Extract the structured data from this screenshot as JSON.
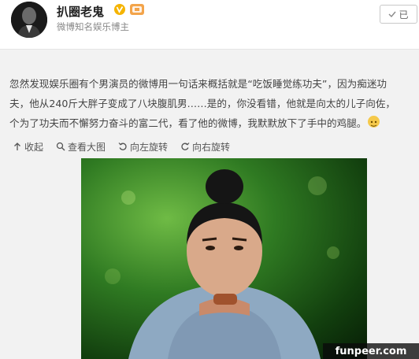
{
  "header": {
    "username": "扒圈老鬼",
    "subtitle": "微博知名娱乐博主",
    "follow_label": "已"
  },
  "post": {
    "lines": [
      "忽然发现娱乐圈有个男演员的微博用一句话来概括就是“吃饭睡觉练功夫”，因为痴迷功",
      "夫，他从240斤大胖子变成了八块腹肌男……是的，你没看错，他就是向太的儿子向佐，",
      "个为了功夫而不懈努力奋斗的富二代，看了他的微博，我默默放下了手中的鸡腿。"
    ]
  },
  "toolbar": {
    "collapse": "收起",
    "view_large": "查看大图",
    "rotate_left": "向左旋转",
    "rotate_right": "向右旋转"
  },
  "watermark": "funpeer.com",
  "colors": {
    "badge": "#f3a44a",
    "verified": "#f5b400",
    "media_bg": "#2f7a22"
  },
  "icons": [
    "verified-icon",
    "level-badge-icon",
    "follow-icon",
    "arrow-up-icon",
    "zoom-icon",
    "rotate-left-icon",
    "rotate-right-icon",
    "emoji-icon"
  ]
}
